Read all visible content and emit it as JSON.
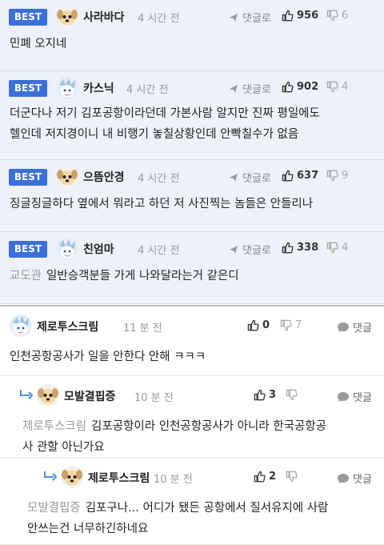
{
  "best_comments": [
    {
      "badge": "BEST",
      "name": "사라바다",
      "time": "4 시간 전",
      "reply_label": "댓글로",
      "up": "956",
      "down": "6",
      "avatar": "dog-avatar",
      "text": [
        "민폐 오지네"
      ]
    },
    {
      "badge": "BEST",
      "name": "카스닉",
      "time": "4 시간 전",
      "reply_label": "댓글로",
      "up": "902",
      "down": "4",
      "avatar": "character-avatar",
      "text": [
        "더군다나 저기 김포공항이라던데 가본사람 알지만 진짜 평일에도",
        "헬인데 저지경이니 내 비행기 놓칠상황인데 안빡칠수가 없음"
      ]
    },
    {
      "badge": "BEST",
      "name": "으뜸안경",
      "time": "4 시간 전",
      "reply_label": "댓글로",
      "up": "637",
      "down": "9",
      "avatar": "dog-avatar",
      "text": [
        "징글징글하다 옆에서 뭐라고 하던 저 사진찍는 놈들은 안들리나"
      ]
    },
    {
      "badge": "BEST",
      "name": "친엄마",
      "time": "4 시간 전",
      "reply_label": "댓글로",
      "up": "338",
      "down": "4",
      "avatar": "character-avatar",
      "mention": "교도관",
      "text": [
        "일반승객분들 가게 나와달라는거 같은디"
      ]
    }
  ],
  "comments": [
    {
      "name": "제로투스크림",
      "time": "11 분 전",
      "up": "0",
      "down": "7",
      "reply_label": "댓글",
      "avatar": "character-avatar",
      "text": [
        "인천공항공사가 일을 안한다 안해 ㅋㅋㅋ"
      ]
    },
    {
      "name": "모발결핍증",
      "time": "10 분 전",
      "up": "3",
      "down": "",
      "reply_label": "댓글",
      "avatar": "dog-avatar",
      "mention": "제로투스크림",
      "text": [
        "김포공항이라 인천공항공사가 아니라 한국공항공",
        "사 관할 아닌가요"
      ]
    },
    {
      "name": "제로투스크림",
      "time": "10 분 전",
      "up": "2",
      "down": "",
      "reply_label": "댓글",
      "avatar": "dog-avatar",
      "mention": "모발결핍증",
      "text": [
        "김포구나... 어디가 됐든 공항에서 질서유지에 사람",
        "안쓰는건 너무하긴하네요"
      ]
    }
  ],
  "colors": {
    "accent": "#3d6fd8",
    "best_bg": "#eef1f9"
  }
}
